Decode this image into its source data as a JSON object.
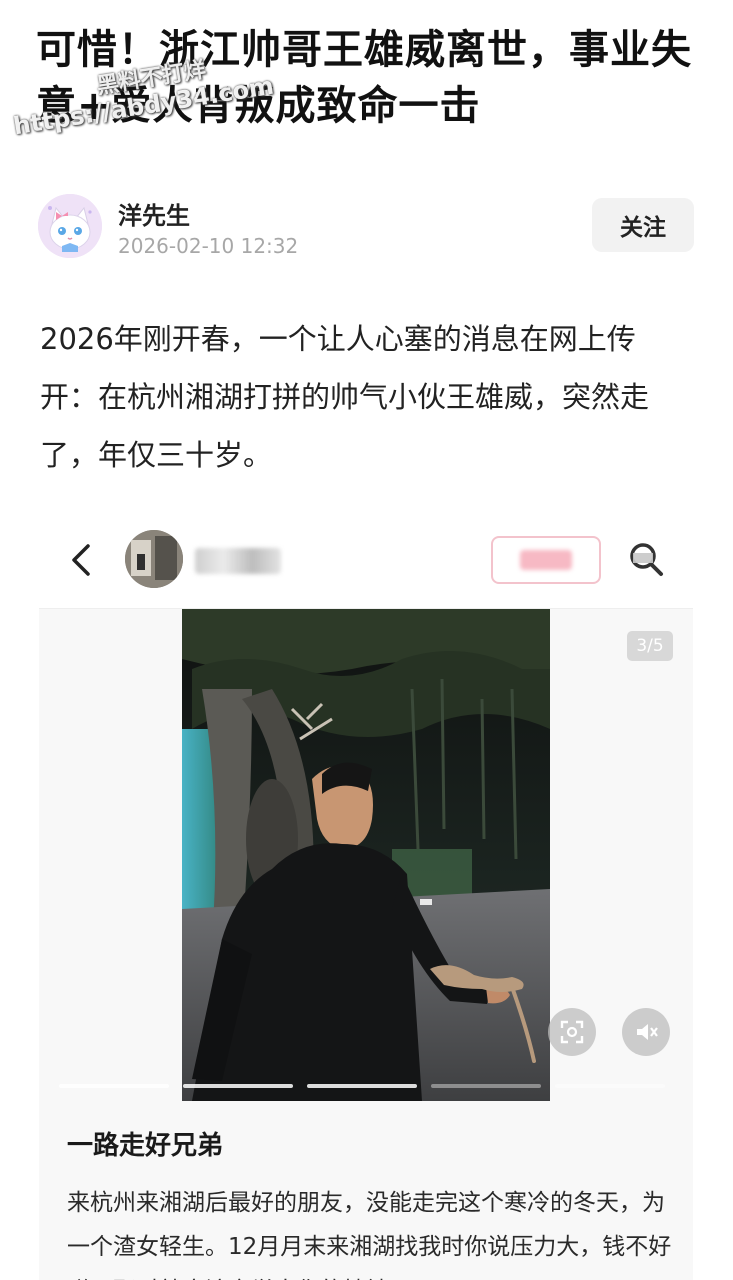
{
  "article": {
    "title": "可惜！浙江帅哥王雄威离世，事业失意+爱人背叛成致命一击",
    "watermark_line1": "黑料不打烊",
    "watermark_line2": "https://abdy34.com",
    "author": {
      "name": "洋先生",
      "time": "2026-02-10 12:32",
      "follow_label": "关注"
    },
    "lead_paragraph": "2026年刚开春，一个让人心塞的消息在网上传开：在杭州湘湖打拼的帅气小伙王雄威，突然走了，年仅三十岁。"
  },
  "embedded_post": {
    "page_indicator": "3/5",
    "caption_title": "一路走好兄弟",
    "caption_body": "来杭州来湘湖后最好的朋友，没能走完这个寒冷的冬天，为一个渣女轻生。12月月末来湘湖找我时你说压力大，钱不好赚，那时就应该察觉出你的精神"
  },
  "icons": {
    "back": "chevron-left-icon",
    "search": "search-icon",
    "scan": "scan-icon",
    "mute": "mute-icon"
  },
  "colors": {
    "accent_follow_border": "#f3c3cc",
    "meta_gray": "#a7a7a7"
  }
}
